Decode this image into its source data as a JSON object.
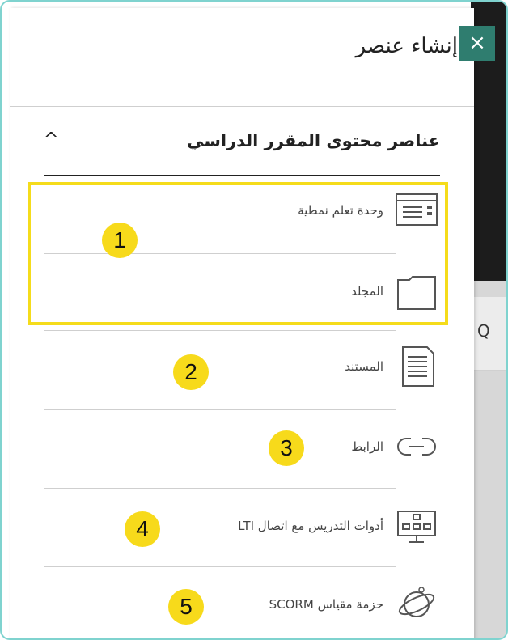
{
  "dialog": {
    "title": "إنشاء عنصر",
    "close_label": "×"
  },
  "section": {
    "title": "عناصر محتوى المقرر الدراسي",
    "chevron": "^"
  },
  "items": [
    {
      "label": "وحدة تعلم نمطية",
      "icon": "learning-module-icon"
    },
    {
      "label": "المجلد",
      "icon": "folder-icon"
    },
    {
      "label": "المستند",
      "icon": "document-icon"
    },
    {
      "label": "الرابط",
      "icon": "link-icon"
    },
    {
      "label": "أدوات التدريس مع اتصال LTI",
      "icon": "lti-tool-icon"
    },
    {
      "label": "حزمة مقياس SCORM",
      "icon": "scorm-package-icon"
    }
  ],
  "badges": [
    "1",
    "2",
    "3",
    "4",
    "5"
  ],
  "background": {
    "search_glyph": "Q"
  },
  "colors": {
    "close_button": "#2f7d6f",
    "highlight": "#f5dc1b",
    "badge": "#f7da1b",
    "frame_border": "#7fd3cf"
  }
}
